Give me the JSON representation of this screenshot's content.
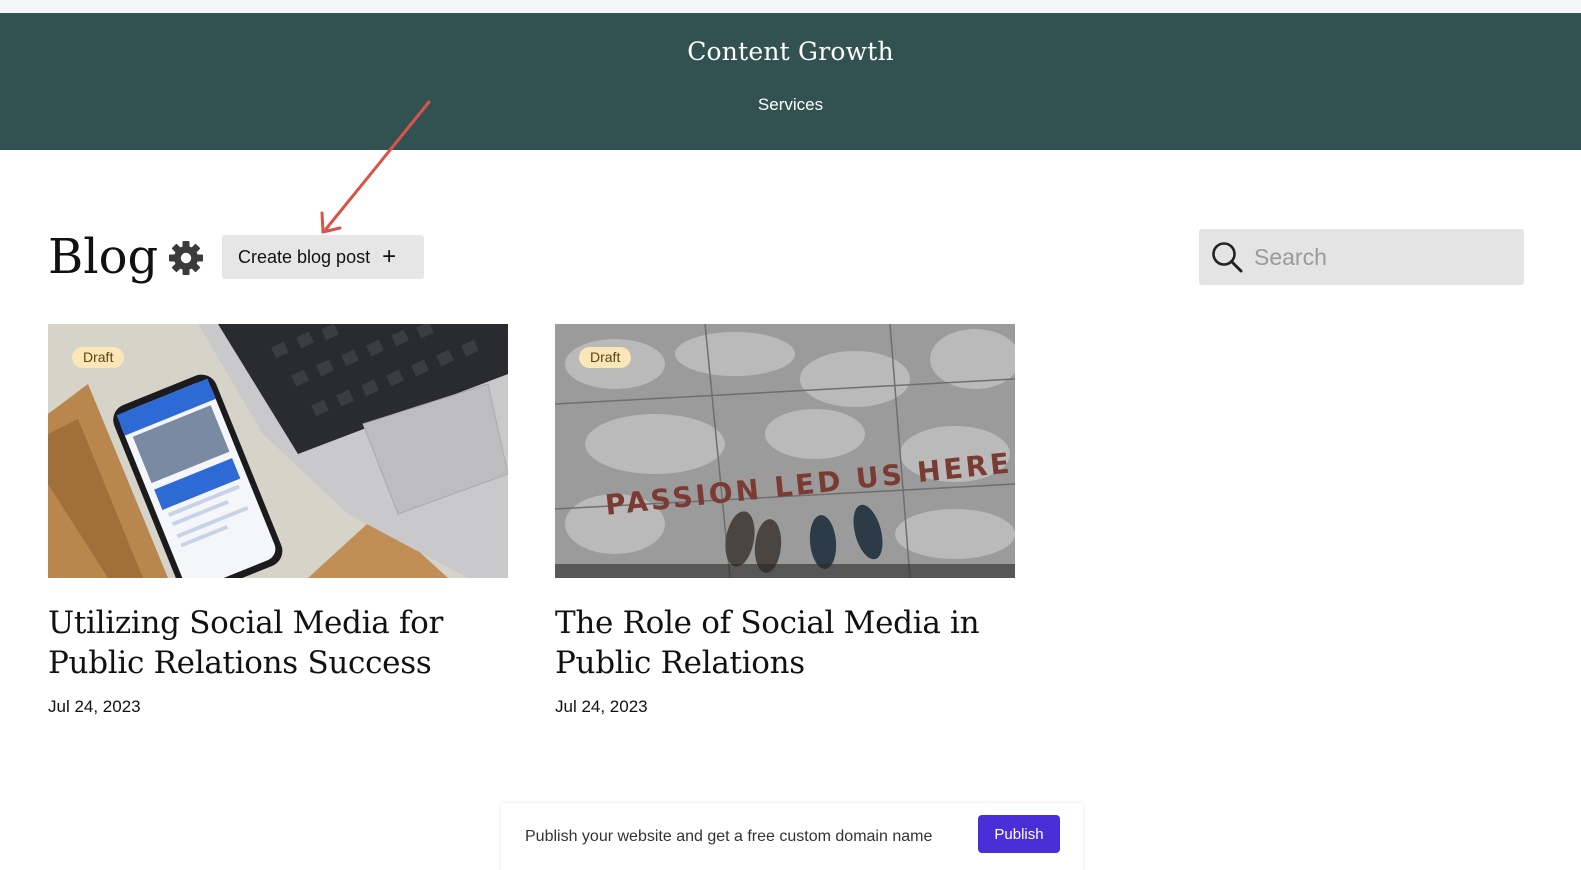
{
  "site": {
    "title": "Content Growth",
    "nav": {
      "services_label": "Services"
    },
    "header_color": "#325252"
  },
  "blog": {
    "heading": "Blog",
    "settings_icon": "gear-icon",
    "create_button_label": "Create blog post",
    "create_button_icon": "+",
    "search_placeholder": "Search"
  },
  "posts": [
    {
      "status": "Draft",
      "title": "Utilizing Social Media for Public Relations Success",
      "date": "Jul 24, 2023",
      "image": "phone-and-laptop-photo"
    },
    {
      "status": "Draft",
      "title": "The Role of Social Media in Public Relations",
      "date": "Jul 24, 2023",
      "image": "passion-led-us-here-photo",
      "image_text": "PASSION LED US HERE"
    }
  ],
  "publish_bar": {
    "message": "Publish your website and get a free custom domain name",
    "button_label": "Publish",
    "button_color": "#4a2fd8"
  },
  "annotation": {
    "arrow_color": "#d9534a"
  }
}
